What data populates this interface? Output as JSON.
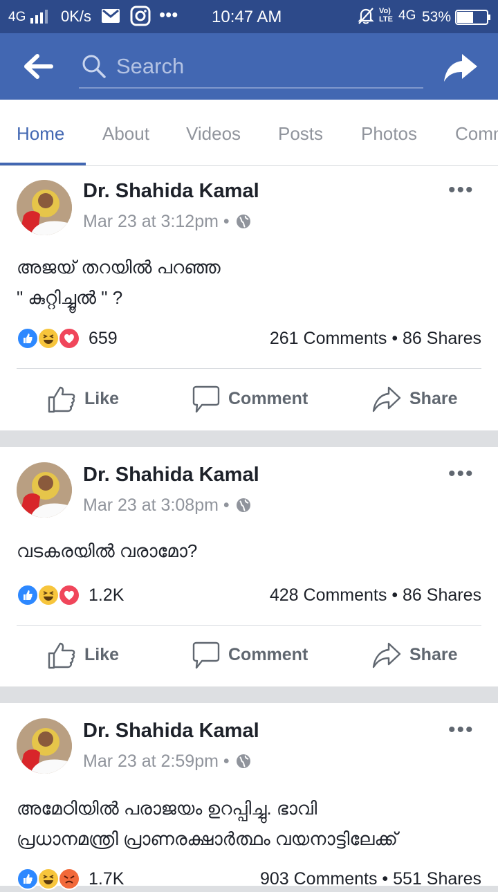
{
  "status_bar": {
    "network": "4G",
    "speed": "0K/s",
    "time": "10:47 AM",
    "volte": "VoLTE",
    "network2": "4G",
    "battery": "53%"
  },
  "header": {
    "search_placeholder": "Search"
  },
  "tabs": [
    {
      "label": "Home",
      "active": true
    },
    {
      "label": "About",
      "active": false
    },
    {
      "label": "Videos",
      "active": false
    },
    {
      "label": "Posts",
      "active": false
    },
    {
      "label": "Photos",
      "active": false
    },
    {
      "label": "Community",
      "active": false
    }
  ],
  "actions": {
    "like": "Like",
    "comment": "Comment",
    "share": "Share"
  },
  "posts": [
    {
      "author": "Dr. Shahida Kamal",
      "time": "Mar 23 at 3:12pm",
      "text_lines": [
        "അജയ് തറയിൽ പറഞ്ഞ",
        "\" കുറ്റിച്ചൂൽ \" ?"
      ],
      "reactions": [
        "like",
        "haha",
        "love"
      ],
      "reaction_count": "659",
      "stats": "261 Comments • 86 Shares"
    },
    {
      "author": "Dr. Shahida Kamal",
      "time": "Mar 23 at 3:08pm",
      "text_lines": [
        "വടകരയിൽ വരാമോ?"
      ],
      "reactions": [
        "like",
        "haha",
        "love"
      ],
      "reaction_count": "1.2K",
      "stats": "428 Comments • 86 Shares"
    },
    {
      "author": "Dr. Shahida Kamal",
      "time": "Mar 23 at 2:59pm",
      "text_lines": [
        "അമേഠിയിൽ പരാജയം ഉറപ്പിച്ചു. ഭാവി",
        "പ്രധാനമന്ത്രി പ്രാണരക്ഷാർത്ഥം വയനാട്ടിലേക്ക്"
      ],
      "reactions": [
        "like",
        "haha",
        "angry"
      ],
      "reaction_count": "1.7K",
      "stats": "903 Comments • 551 Shares"
    }
  ],
  "colors": {
    "brand": "#4267b2",
    "status_bar": "#2d4a8a",
    "like": "#2d88ff",
    "haha": "#f7c53c",
    "love": "#f0465b",
    "angry": "#f2693a"
  }
}
